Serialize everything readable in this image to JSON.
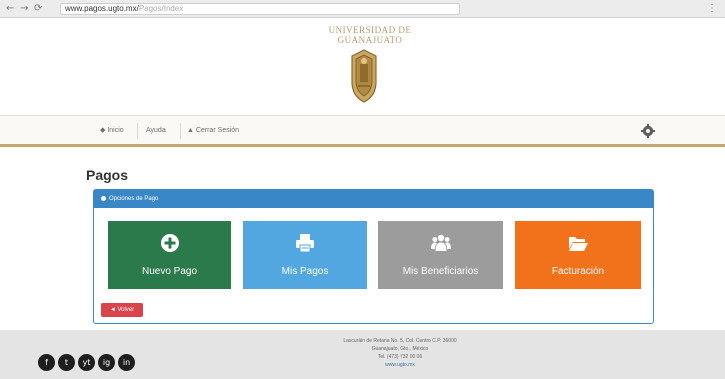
{
  "browser": {
    "url_host": "www.pagos.ugto.mx/",
    "url_path": "Pagos/Index",
    "back_glyph": "←",
    "forward_glyph": "→",
    "reload_glyph": "⟳",
    "menu_glyph": "⋮"
  },
  "header": {
    "uni_line1": "UNIVERSIDAD DE",
    "uni_line2": "GUANAJUATO"
  },
  "navbar": {
    "items": [
      {
        "icon": "home-icon",
        "label": "◆ Inicio"
      },
      {
        "icon": "info-icon",
        "label": "Ayuda"
      },
      {
        "icon": "user-icon",
        "label": "▲ Cerrar Sesión"
      }
    ]
  },
  "main": {
    "title": "Pagos",
    "panel_title": "Opciones de Pago",
    "tiles": [
      {
        "label": "Nuevo Pago",
        "icon": "plus-circle-icon",
        "color": "#2b7a4b"
      },
      {
        "label": "Mis Pagos",
        "icon": "print-icon",
        "color": "#52a7e0"
      },
      {
        "label": "Mis Beneficiarios",
        "icon": "users-icon",
        "color": "#9c9c9c"
      },
      {
        "label": "Facturación",
        "icon": "folder-open-icon",
        "color": "#f2711b"
      }
    ],
    "back_label": "◄ Volver"
  },
  "footer": {
    "social": [
      "f",
      "t",
      "yt",
      "ig",
      "in"
    ],
    "lines": [
      "Lascuráin de Retana No. 5, Col. Centro C.P. 36000",
      "Guanajuato, Gto., México",
      "Tel. (473) 732 00 06",
      "www.ugto.mx"
    ]
  }
}
